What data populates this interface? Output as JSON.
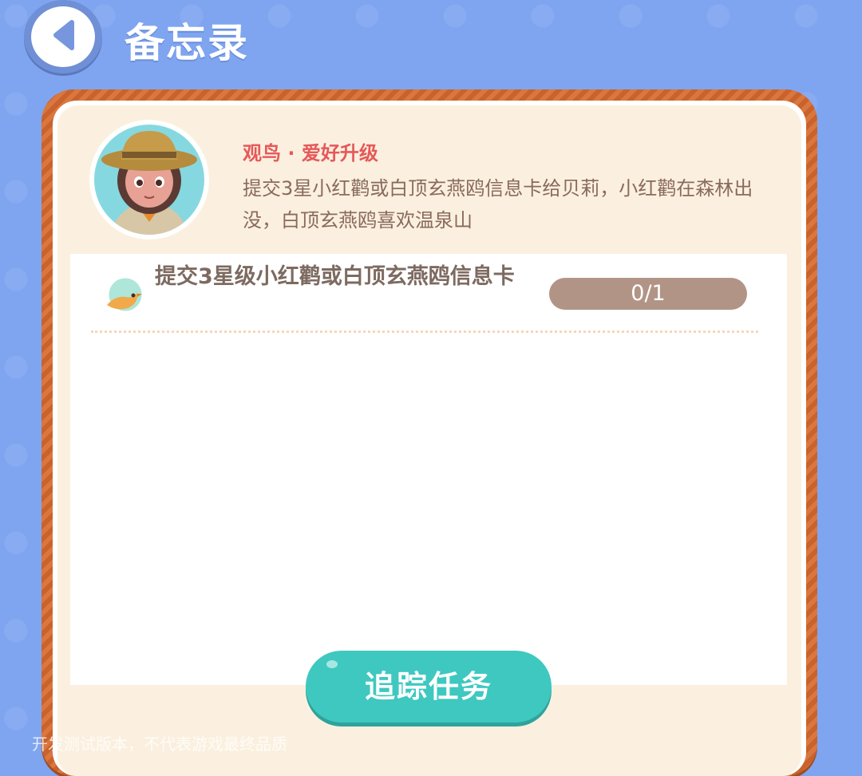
{
  "header": {
    "title": "备忘录",
    "back_icon": "chevron-left-icon"
  },
  "quest": {
    "title": "观鸟 · 爱好升级",
    "description": "提交3星小红鹳或白顶玄燕鸥信息卡给贝莉，小红鹳在森林出没，白顶玄燕鸥喜欢温泉山",
    "avatar_icon": "explorer-avatar"
  },
  "task": {
    "icon": "bird-icon",
    "text": "提交3星级小红鹳或白顶玄燕鸥信息卡",
    "progress": "0/1"
  },
  "actions": {
    "track_label": "追踪任务"
  },
  "watermark": "开发测试版本，不代表游戏最终品质",
  "colors": {
    "background": "#7fa5f0",
    "frame": "#c9622c",
    "card": "#fbf0df",
    "quest_title": "#e5595a",
    "button": "#3ec8c0",
    "progress": "#b29486"
  }
}
